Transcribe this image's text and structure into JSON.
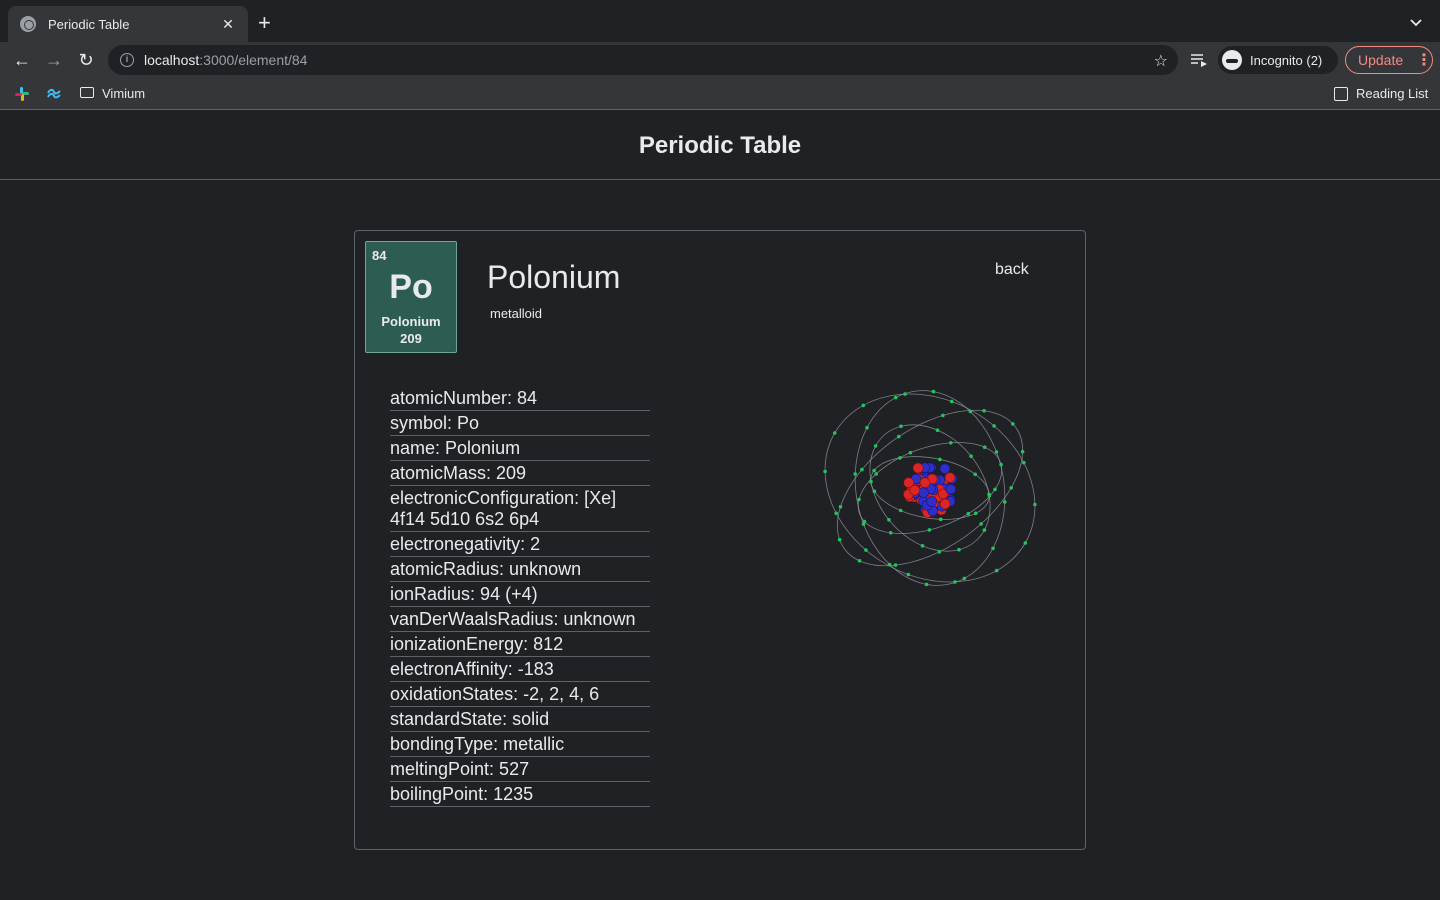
{
  "browser": {
    "tab_title": "Periodic Table",
    "url_host": "localhost",
    "url_path": ":3000/element/84",
    "profile_label": "Incognito (2)",
    "update_label": "Update",
    "bookmark_folder": "Vimium",
    "reading_list": "Reading List"
  },
  "page": {
    "title": "Periodic Table"
  },
  "element": {
    "number": "84",
    "symbol": "Po",
    "name": "Polonium",
    "mass": "209",
    "category": "metalloid",
    "back_label": "back",
    "tile_color": "#2d5d52",
    "properties": [
      "atomicNumber: 84",
      "symbol: Po",
      "name: Polonium",
      "atomicMass: 209",
      "electronicConfiguration: [Xe] 4f14 5d10 6s2 6p4",
      "electronegativity: 2",
      "atomicRadius: unknown",
      "ionRadius: 94 (+4)",
      "vanDerWaalsRadius: unknown",
      "ionizationEnergy: 812",
      "electronAffinity: -183",
      "oxidationStates: -2, 2, 4, 6",
      "standardState: solid",
      "bondingType: metallic",
      "meltingPoint: 527",
      "boilingPoint: 1235"
    ]
  },
  "colors": {
    "background": "#202124",
    "electron": "#22c55e",
    "proton": "#dc2626",
    "neutron": "#2e2ec9"
  }
}
